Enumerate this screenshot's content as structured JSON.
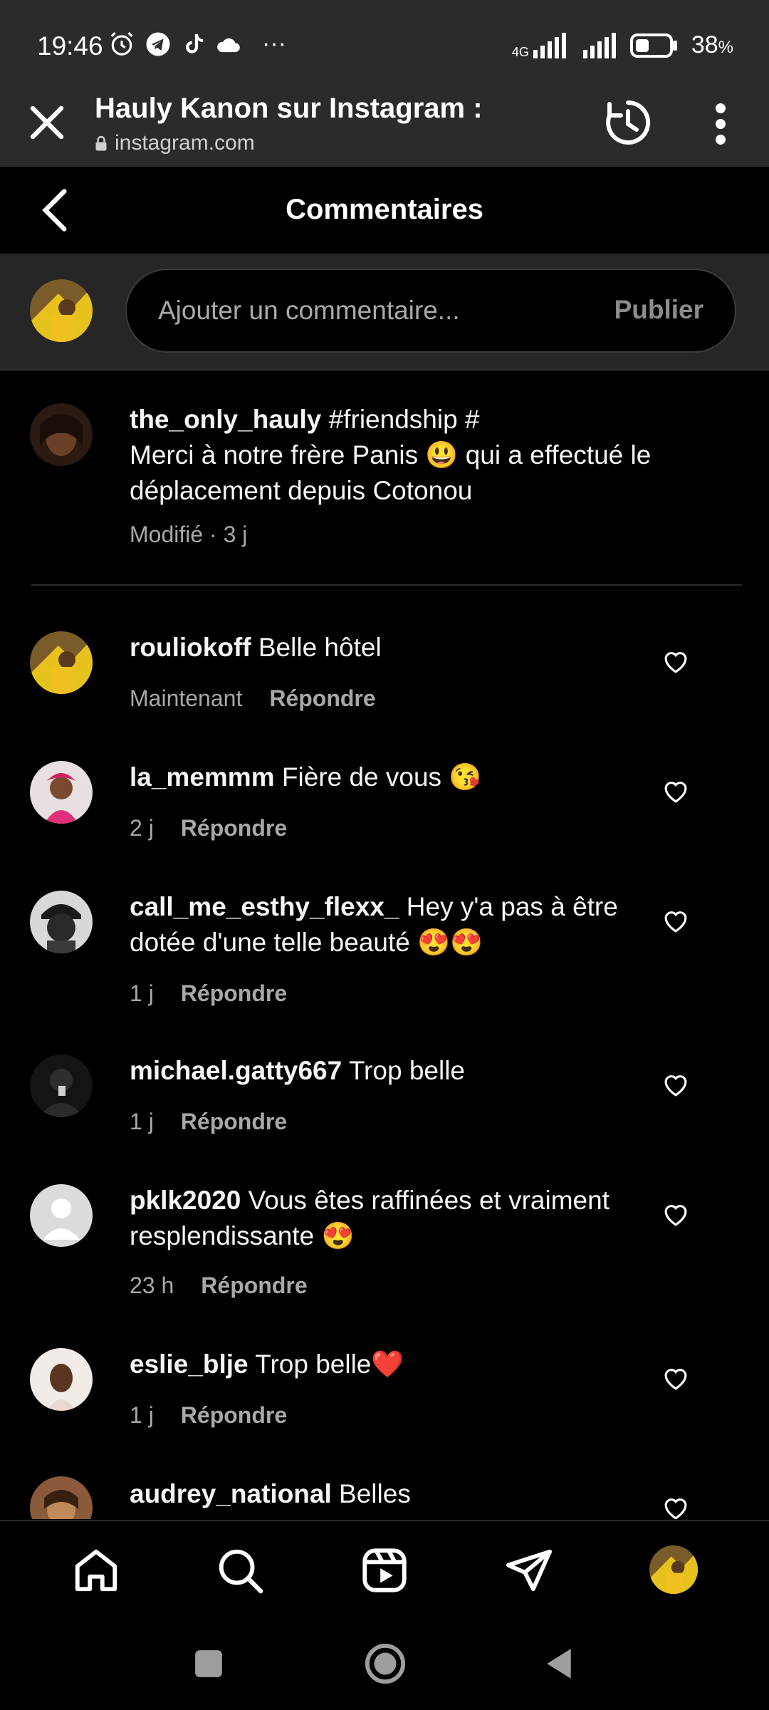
{
  "status": {
    "time": "19:46",
    "network": "4G",
    "battery": "38",
    "battery_unit": "%"
  },
  "appbar": {
    "title": "Hauly Kanon sur Instagram :",
    "url": "instagram.com"
  },
  "header": {
    "title": "Commentaires"
  },
  "composer": {
    "placeholder": "Ajouter un commentaire...",
    "publish_label": "Publier"
  },
  "caption": {
    "username": "the_only_hauly",
    "text_line": " #friendship #",
    "body": "Merci à notre frère Panis 😃 qui a effectué le déplacement depuis Cotonou",
    "meta": "Modifié · 3 j"
  },
  "comments": [
    {
      "username": "rouliokoff",
      "text": " Belle hôtel",
      "time": "Maintenant",
      "reply": "Répondre"
    },
    {
      "username": "la_memmm",
      "text": " Fière de vous 😘",
      "time": "2 j",
      "reply": "Répondre"
    },
    {
      "username": "call_me_esthy_flexx_",
      "text": " Hey y'a pas à être dotée d'une telle beauté 😍😍",
      "time": "1 j",
      "reply": "Répondre"
    },
    {
      "username": "michael.gatty667",
      "text": " Trop belle",
      "time": "1 j",
      "reply": "Répondre"
    },
    {
      "username": "pklk2020",
      "text": " Vous êtes raffinées et vraiment resplendissante 😍",
      "time": "23 h",
      "reply": "Répondre"
    },
    {
      "username": "eslie_blje",
      "text": " Trop belle❤️",
      "time": "1 j",
      "reply": "Répondre"
    },
    {
      "username": "audrey_national",
      "text": " Belles",
      "time": "",
      "reply": ""
    }
  ],
  "nav": {
    "items": [
      "home-icon",
      "search-icon",
      "reels-icon",
      "direct-icon",
      "profile-avatar"
    ]
  }
}
